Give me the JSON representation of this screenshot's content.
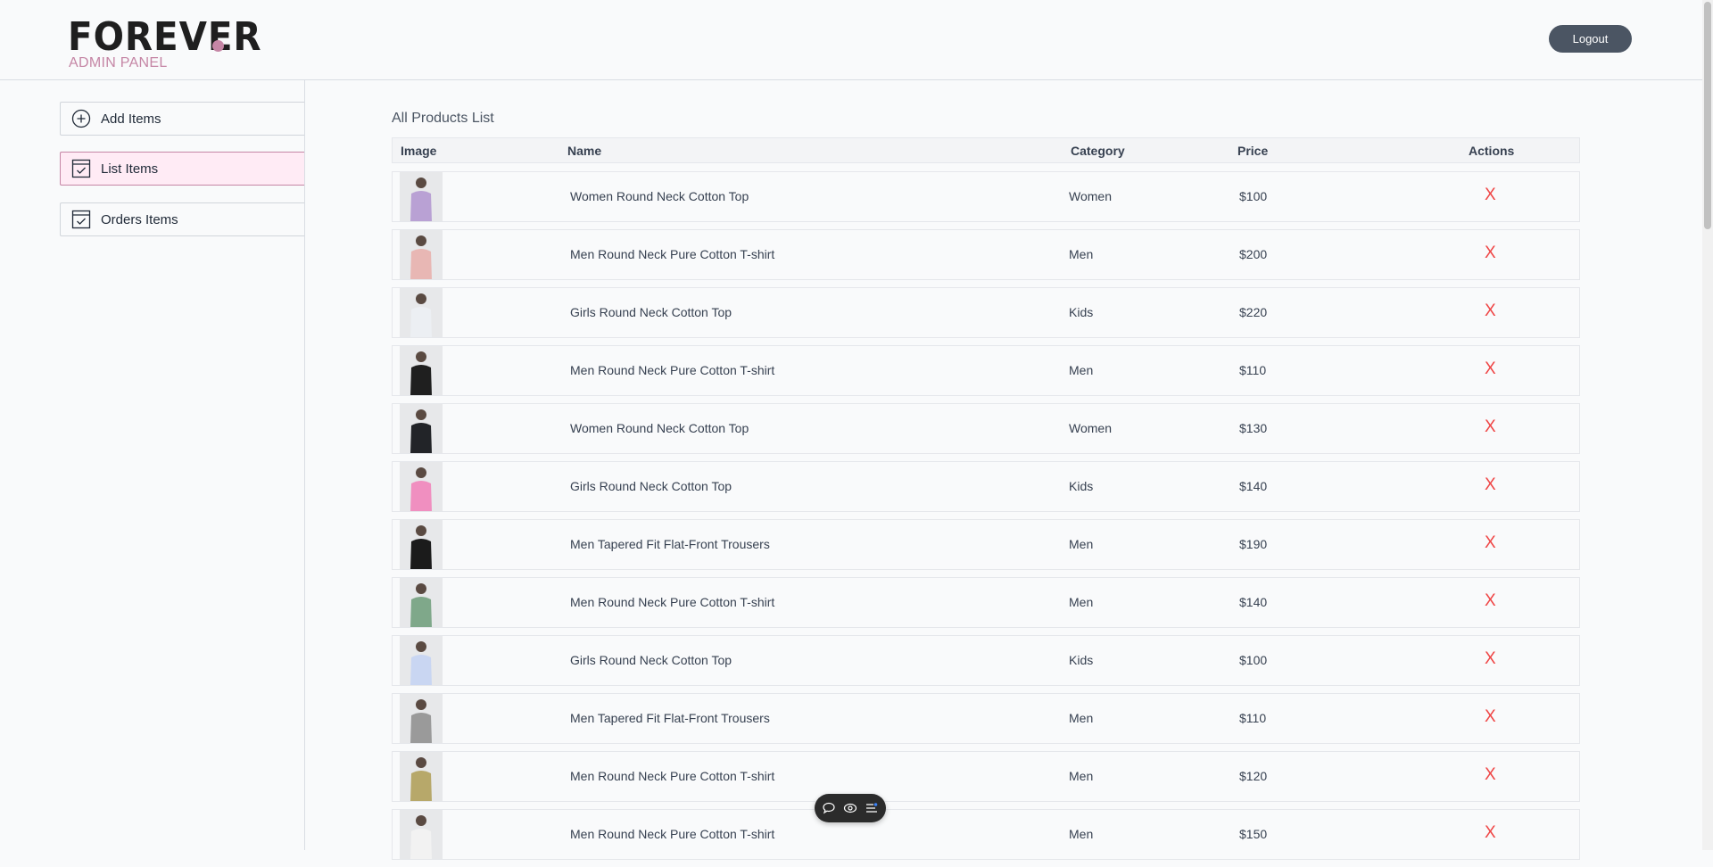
{
  "brand": {
    "logo_text": "FOREVER",
    "subtitle": "ADMIN PANEL",
    "accent_color": "#c586a5"
  },
  "header": {
    "logout_label": "Logout"
  },
  "sidebar": {
    "items": [
      {
        "label": "Add Items",
        "icon": "plus-circle-icon",
        "active": false
      },
      {
        "label": "List Items",
        "icon": "checklist-icon",
        "active": true
      },
      {
        "label": "Orders Items",
        "icon": "checklist-icon",
        "active": false
      }
    ]
  },
  "main": {
    "title": "All Products List",
    "columns": [
      "Image",
      "Name",
      "Category",
      "Price",
      "Actions"
    ],
    "rows": [
      {
        "name": "Women Round Neck Cotton Top",
        "category": "Women",
        "price": "$100",
        "action": "X",
        "thumb_color": "#b9a1d4"
      },
      {
        "name": "Men Round Neck Pure Cotton T-shirt",
        "category": "Men",
        "price": "$200",
        "action": "X",
        "thumb_color": "#e8b7b4"
      },
      {
        "name": "Girls Round Neck Cotton Top",
        "category": "Kids",
        "price": "$220",
        "action": "X",
        "thumb_color": "#eceff3"
      },
      {
        "name": "Men Round Neck Pure Cotton T-shirt",
        "category": "Men",
        "price": "$110",
        "action": "X",
        "thumb_color": "#1f1f1f"
      },
      {
        "name": "Women Round Neck Cotton Top",
        "category": "Women",
        "price": "$130",
        "action": "X",
        "thumb_color": "#222428"
      },
      {
        "name": "Girls Round Neck Cotton Top",
        "category": "Kids",
        "price": "$140",
        "action": "X",
        "thumb_color": "#f08fc0"
      },
      {
        "name": "Men Tapered Fit Flat-Front Trousers",
        "category": "Men",
        "price": "$190",
        "action": "X",
        "thumb_color": "#1b1b1b"
      },
      {
        "name": "Men Round Neck Pure Cotton T-shirt",
        "category": "Men",
        "price": "$140",
        "action": "X",
        "thumb_color": "#7fa88a"
      },
      {
        "name": "Girls Round Neck Cotton Top",
        "category": "Kids",
        "price": "$100",
        "action": "X",
        "thumb_color": "#c9d6f2"
      },
      {
        "name": "Men Tapered Fit Flat-Front Trousers",
        "category": "Men",
        "price": "$110",
        "action": "X",
        "thumb_color": "#9a9a9a"
      },
      {
        "name": "Men Round Neck Pure Cotton T-shirt",
        "category": "Men",
        "price": "$120",
        "action": "X",
        "thumb_color": "#b7a86a"
      },
      {
        "name": "Men Round Neck Pure Cotton T-shirt",
        "category": "Men",
        "price": "$150",
        "action": "X",
        "thumb_color": "#f2f2f2"
      }
    ]
  },
  "floating_toolbar": {
    "icons": [
      "comment-icon",
      "eye-icon",
      "list-settings-icon"
    ]
  }
}
